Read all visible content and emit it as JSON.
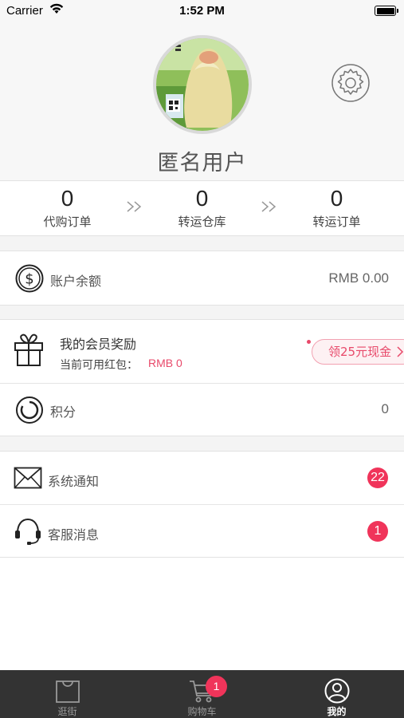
{
  "status_bar": {
    "carrier": "Carrier",
    "time": "1:52 PM"
  },
  "profile": {
    "username": "匿名用户"
  },
  "orders": [
    {
      "count": "0",
      "label": "代购订单"
    },
    {
      "count": "0",
      "label": "转运仓库"
    },
    {
      "count": "0",
      "label": "转运订单"
    }
  ],
  "account": {
    "label": "账户余额",
    "value": "RMB 0.00"
  },
  "membership": {
    "title": "我的会员奖励",
    "available_label": "当前可用红包：",
    "available_value": "RMB 0",
    "promo_button": "领25元现金"
  },
  "points": {
    "label": "积分",
    "value": "0"
  },
  "messages": [
    {
      "label": "系统通知",
      "badge": "22"
    },
    {
      "label": "客服消息",
      "badge": "1"
    }
  ],
  "tabbar": {
    "tabs": [
      {
        "label": "逛街",
        "active": false
      },
      {
        "label": "购物车",
        "active": false
      },
      {
        "label": "我的",
        "active": true
      }
    ],
    "cart_badge": "1"
  },
  "colors": {
    "accent": "#f0345a",
    "tabbar_bg": "#333333",
    "promo_text": "#e8496a"
  }
}
